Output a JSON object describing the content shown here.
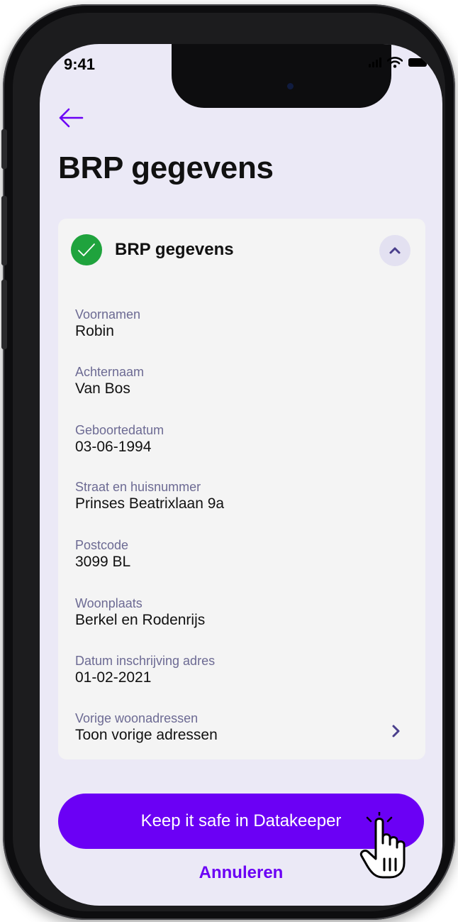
{
  "status_bar": {
    "time": "9:41"
  },
  "header": {
    "back_icon": "arrow-left-icon",
    "title": "BRP gegevens"
  },
  "card": {
    "title": "BRP gegevens",
    "status_icon": "check-circle-icon",
    "collapse_icon": "chevron-up-icon",
    "fields": [
      {
        "label": "Voornamen",
        "value": "Robin"
      },
      {
        "label": "Achternaam",
        "value": "Van Bos"
      },
      {
        "label": "Geboortedatum",
        "value": "03-06-1994"
      },
      {
        "label": "Straat en huisnummer",
        "value": "Prinses Beatrixlaan 9a"
      },
      {
        "label": "Postcode",
        "value": "3099 BL"
      },
      {
        "label": "Woonplaats",
        "value": "Berkel en Rodenrijs"
      },
      {
        "label": "Datum inschrijving adres",
        "value": "01-02-2021"
      },
      {
        "label": "Vorige woonadressen",
        "value": "Toon vorige adressen"
      }
    ]
  },
  "actions": {
    "primary_label": "Keep it safe in Datakeeper",
    "cancel_label": "Annuleren"
  },
  "colors": {
    "accent": "#6b00f5",
    "success": "#1fa33d",
    "screen_background": "#ebe9f6",
    "card_background": "#f4f4f4"
  }
}
